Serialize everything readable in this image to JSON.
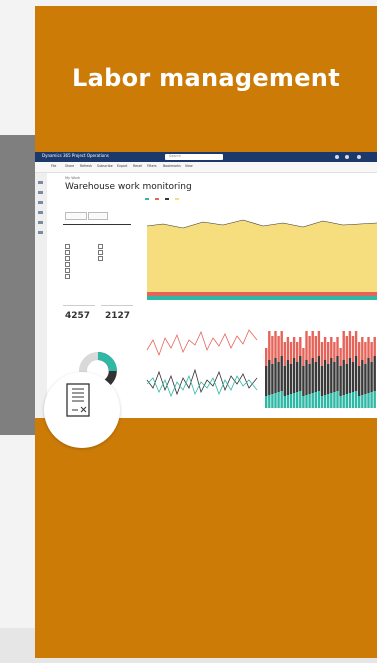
{
  "card": {
    "title": "Labor management",
    "background": "#cc7b07"
  },
  "screenshot": {
    "app_name": "Dynamics 365 Project Operations",
    "search_placeholder": "Search",
    "commands": [
      "File",
      "Share",
      "Refresh",
      "Subscribe",
      "Export",
      "Reset",
      "Filters",
      "Bookmarks",
      "View"
    ],
    "breadcrumb": "My Work",
    "page_title": "Warehouse work monitoring",
    "kpis": [
      "4257",
      "2127"
    ],
    "colors": {
      "topbar": "#1b3a6b",
      "area_fill": "#f6de7e",
      "teal": "#30b8a6",
      "red": "#e6635a",
      "dark": "#3a3a3a"
    }
  },
  "badge": {
    "icon": "document-cancel-icon"
  }
}
